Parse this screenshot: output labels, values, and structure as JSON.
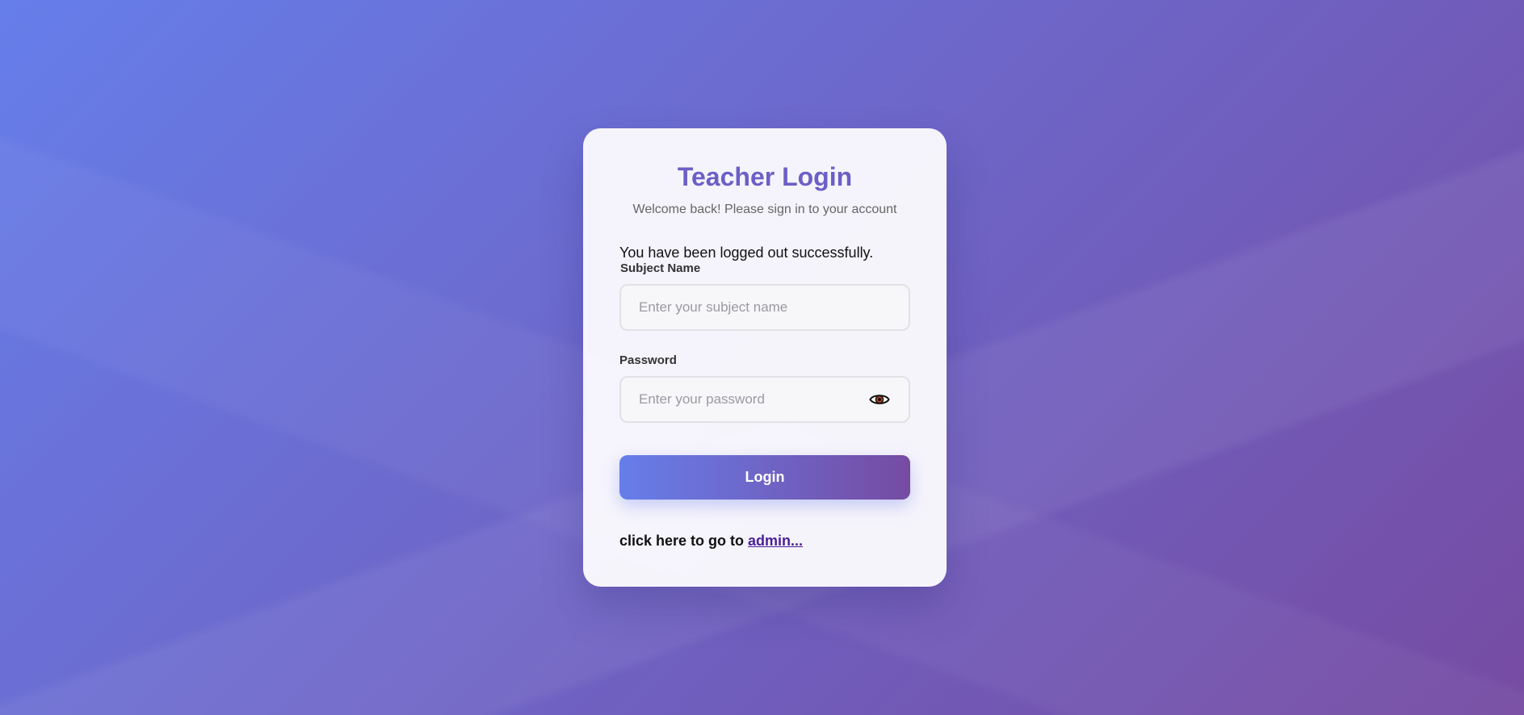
{
  "page": {
    "title": "Teacher Login",
    "subtitle": "Welcome back! Please sign in to your account",
    "message": "You have been logged out successfully."
  },
  "form": {
    "subject": {
      "label": "Subject Name",
      "placeholder": "Enter your subject name",
      "value": ""
    },
    "password": {
      "label": "Password",
      "placeholder": "Enter your password",
      "value": "",
      "toggle_icon": "eye-icon"
    },
    "submit_label": "Login"
  },
  "footer": {
    "prefix": "click here to go to ",
    "link_text": "admin..."
  },
  "colors": {
    "accent": "#6c5fc6",
    "gradient_start": "#667eea",
    "gradient_end": "#764ba2",
    "link": "#4a1f9a"
  }
}
